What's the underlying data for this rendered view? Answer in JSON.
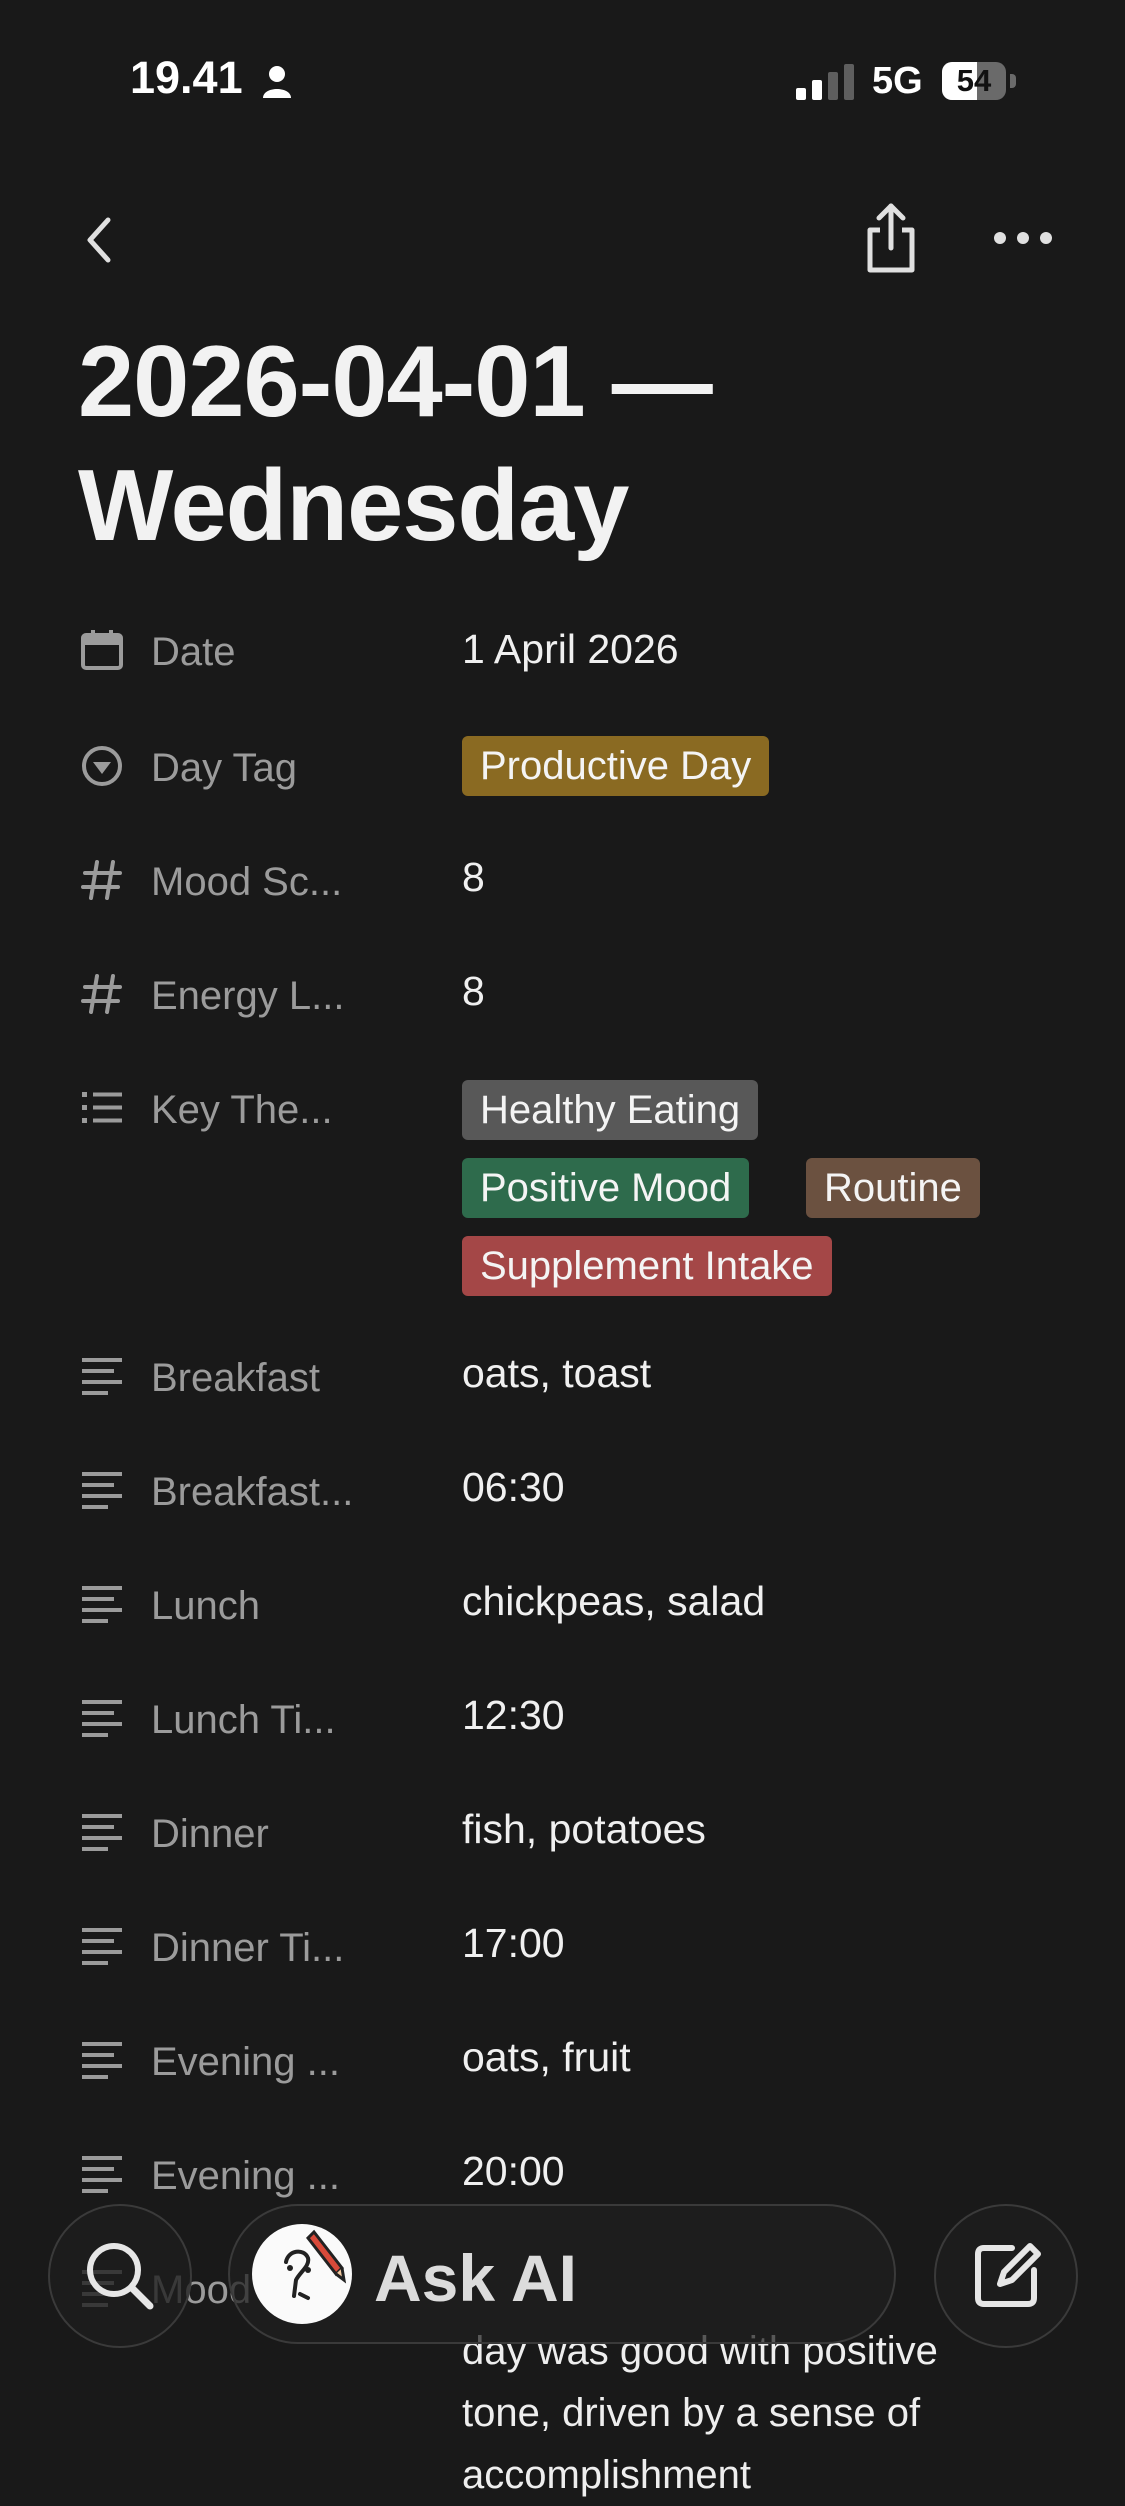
{
  "status_bar": {
    "time": "19.41",
    "network": "5G",
    "battery_level": "54",
    "battery_fraction": 0.54
  },
  "page": {
    "title": "2026-04-01 — Wednesday"
  },
  "properties": [
    {
      "icon": "calendar-icon",
      "label": "Date",
      "value": "1 April 2026"
    },
    {
      "icon": "select-icon",
      "label": "Day Tag",
      "tags": [
        {
          "text": "Productive Day",
          "color": "#8a6a22"
        }
      ]
    },
    {
      "icon": "number-icon",
      "label": "Mood Sc...",
      "value": "8"
    },
    {
      "icon": "number-icon",
      "label": "Energy L...",
      "value": "8"
    },
    {
      "icon": "list-icon",
      "label": "Key The...",
      "tags": [
        {
          "text": "Healthy Eating",
          "color": "#585858"
        },
        {
          "text": "Positive Mood",
          "color": "#2e6b4c"
        },
        {
          "text": "Routine",
          "color": "#6b5140"
        },
        {
          "text": "Supplement Intake",
          "color": "#a44747"
        }
      ]
    },
    {
      "icon": "text-icon",
      "label": "Breakfast",
      "value": "oats, toast"
    },
    {
      "icon": "text-icon",
      "label": "Breakfast...",
      "value": "06:30"
    },
    {
      "icon": "text-icon",
      "label": "Lunch",
      "value": "chickpeas, salad"
    },
    {
      "icon": "text-icon",
      "label": "Lunch Ti...",
      "value": "12:30"
    },
    {
      "icon": "text-icon",
      "label": "Dinner",
      "value": "fish, potatoes"
    },
    {
      "icon": "text-icon",
      "label": "Dinner Ti...",
      "value": "17:00"
    },
    {
      "icon": "text-icon",
      "label": "Evening ...",
      "value": "oats, fruit"
    },
    {
      "icon": "text-icon",
      "label": "Evening ...",
      "value": "20:00"
    },
    {
      "icon": "text-icon",
      "label": "Mood",
      "value": "day was good with positive tone, driven by a sense of accomplishment"
    }
  ],
  "bottom_bar": {
    "ask_ai_label": "Ask AI"
  }
}
